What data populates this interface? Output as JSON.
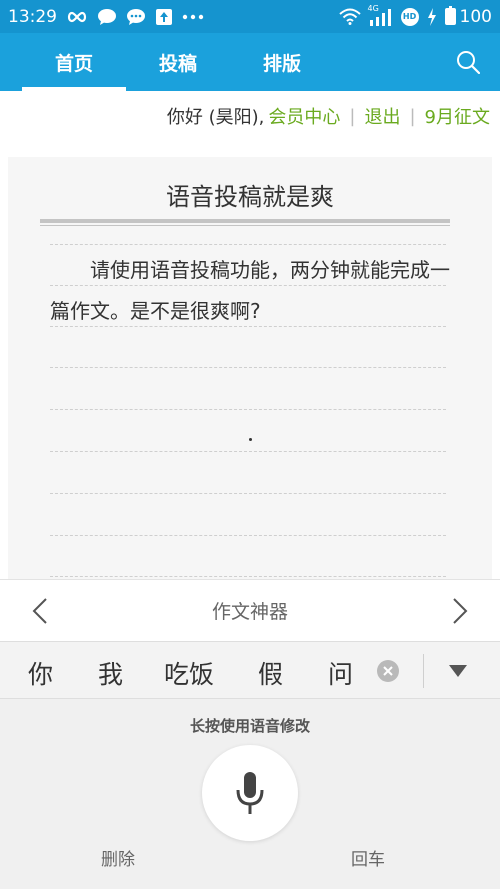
{
  "status_bar": {
    "time": "13:29",
    "network": "4G",
    "hd": "HD",
    "battery": "100",
    "icons": [
      "infinity-icon",
      "chat-bubble-icon",
      "chat-bubble-2-icon",
      "upload-icon",
      "more-icon",
      "wifi-icon",
      "signal-icon",
      "hd-icon",
      "charging-icon",
      "battery-icon"
    ]
  },
  "nav": {
    "tabs": [
      {
        "label": "首页",
        "active": true
      },
      {
        "label": "投稿",
        "active": false
      },
      {
        "label": "排版",
        "active": false
      }
    ],
    "search_icon": "search-icon"
  },
  "user": {
    "greeting": "你好 (昊阳),",
    "member_center": "会员中心",
    "logout": "退出",
    "event": "9月征文"
  },
  "paper": {
    "title": "语音投稿就是爽",
    "body": "请使用语音投稿功能，两分钟就能完成一篇作文。是不是很爽啊?"
  },
  "tool_bar": {
    "title": "作文神器",
    "prev_icon": "chevron-left-icon",
    "next_icon": "chevron-right-icon"
  },
  "candidates": {
    "items": [
      "你",
      "我",
      "吃饭",
      "假",
      "问"
    ],
    "clear_icon": "clear-icon",
    "more_icon": "triangle-down-icon"
  },
  "voice": {
    "hint": "长按使用语音修改",
    "mic_icon": "microphone-icon",
    "delete_label": "删除",
    "enter_label": "回车"
  },
  "colors": {
    "status_bar_bg": "#1594cf",
    "nav_bg": "#1ba1dc",
    "link_green": "#6aaa1f"
  }
}
